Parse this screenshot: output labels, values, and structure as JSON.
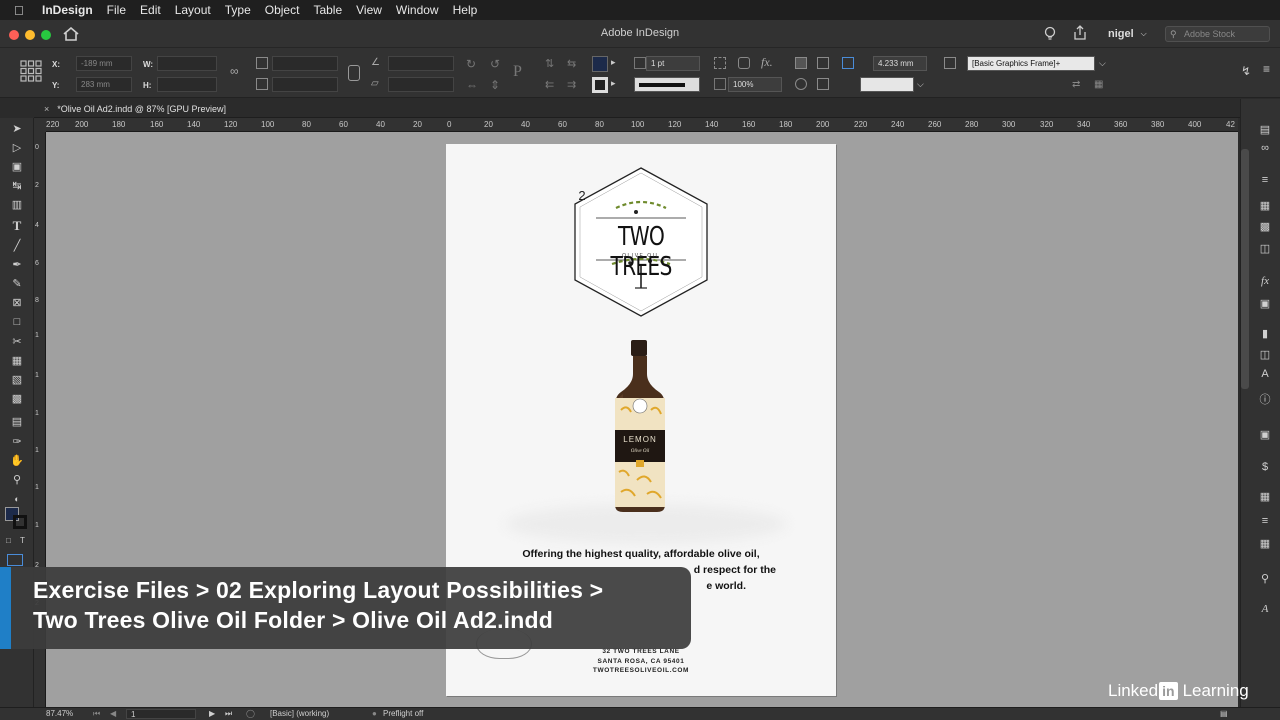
{
  "menubar": {
    "app": "InDesign",
    "items": [
      "File",
      "Edit",
      "Layout",
      "Type",
      "Object",
      "Table",
      "View",
      "Window",
      "Help"
    ]
  },
  "window": {
    "title": "Adobe InDesign",
    "user": "nigel",
    "stock_placeholder": "Adobe Stock"
  },
  "control": {
    "x_label": "X:",
    "x_value": "-189 mm",
    "y_label": "Y:",
    "y_value": "283 mm",
    "w_label": "W:",
    "h_label": "H:",
    "stroke_weight": "1 pt",
    "opacity": "100%",
    "offset": "4.233 mm",
    "object_style": "[Basic Graphics Frame]+",
    "fill_color": "#1c2a4a"
  },
  "document": {
    "tab_title": "*Olive Oil Ad2.indd @ 87% [GPU Preview]"
  },
  "ruler": {
    "h_ticks": [
      "220",
      "200",
      "180",
      "160",
      "140",
      "120",
      "100",
      "80",
      "60",
      "40",
      "20",
      "0",
      "20",
      "40",
      "60",
      "80",
      "100",
      "120",
      "140",
      "160",
      "180",
      "200",
      "220",
      "240",
      "260",
      "280",
      "300",
      "320",
      "340",
      "360",
      "380",
      "400",
      "42"
    ],
    "v_ticks": [
      "0",
      "2",
      "4",
      "6",
      "8",
      "1",
      "1",
      "1",
      "1",
      "1",
      "1",
      "2",
      "2"
    ]
  },
  "ad": {
    "logo_line1": "TWO TREES",
    "logo_line2": "OLIVE OIL",
    "logo_number": "2",
    "bottle_label": "LEMON",
    "bottle_sub": "Olive Oil",
    "copy_line1": "Offering the highest quality, affordable olive oil,",
    "copy_line2": "d respect for the",
    "copy_line3": "e world.",
    "address_line1": "32 TWO TREES LANE",
    "address_line2": "SANTA ROSA, CA 95401",
    "address_line3": "TWOTREESOLIVEOIL.COM"
  },
  "status": {
    "zoom": "87.47%",
    "page": "1",
    "profile": "[Basic] (working)",
    "preflight": "Preflight off"
  },
  "overlay": {
    "line1": "Exercise Files > 02 Exploring Layout Possibilities >",
    "line2": "Two Trees Olive Oil Folder > Olive Oil Ad2.indd"
  },
  "watermark": {
    "left": "Linked",
    "in": "in",
    "right": "Learning"
  },
  "colors": {
    "accent": "#1f7fc7",
    "canvas": "#a0a0a0",
    "panel": "#323232"
  }
}
